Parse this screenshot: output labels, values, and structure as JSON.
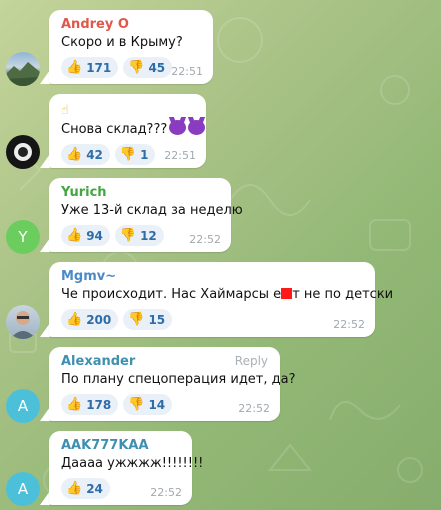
{
  "colors": {
    "sender_andrey": "#e0584a",
    "sender_green": "#43a642",
    "sender_blue": "#4a8ac8",
    "sender_teal": "#3f8fb0",
    "reaction_bg": "#eaf0f7",
    "reaction_text": "#2e6da8",
    "avatar_y": "#6ccd5f",
    "avatar_a": "#4dc0d9"
  },
  "messages": [
    {
      "sender": "Andrey O",
      "text": "Скоро и в Крыму?",
      "likes": "171",
      "dislikes": "45",
      "time": "22:51",
      "avatar": "photo-landscape"
    },
    {
      "sender": "",
      "emoji_line": "☝",
      "text": "Снова склад???",
      "likes": "42",
      "dislikes": "1",
      "time": "22:51",
      "avatar": "photo-dark"
    },
    {
      "sender": "Yurich",
      "text": "Уже 13-й склад за неделю",
      "likes": "94",
      "dislikes": "12",
      "time": "22:52",
      "avatar_letter": "Y"
    },
    {
      "sender": "Mgmv~",
      "text_before": "Че происходит. Нас Хаймарсы е",
      "text_after": "т не по детски",
      "likes": "200",
      "dislikes": "15",
      "time": "22:52",
      "avatar": "photo-man"
    },
    {
      "sender": "Alexander",
      "reply_label": "Reply",
      "text": "По плану спецоперация идет, да?",
      "likes": "178",
      "dislikes": "14",
      "time": "22:52",
      "avatar_letter": "A"
    },
    {
      "sender": "AAK777KAA",
      "text": "Даааа ужжжж!!!!!!!!",
      "likes": "24",
      "time": "22:52",
      "avatar_letter": "A"
    }
  ],
  "icons": {
    "like": "thumbs-up-icon",
    "dislike": "thumbs-down-icon"
  }
}
